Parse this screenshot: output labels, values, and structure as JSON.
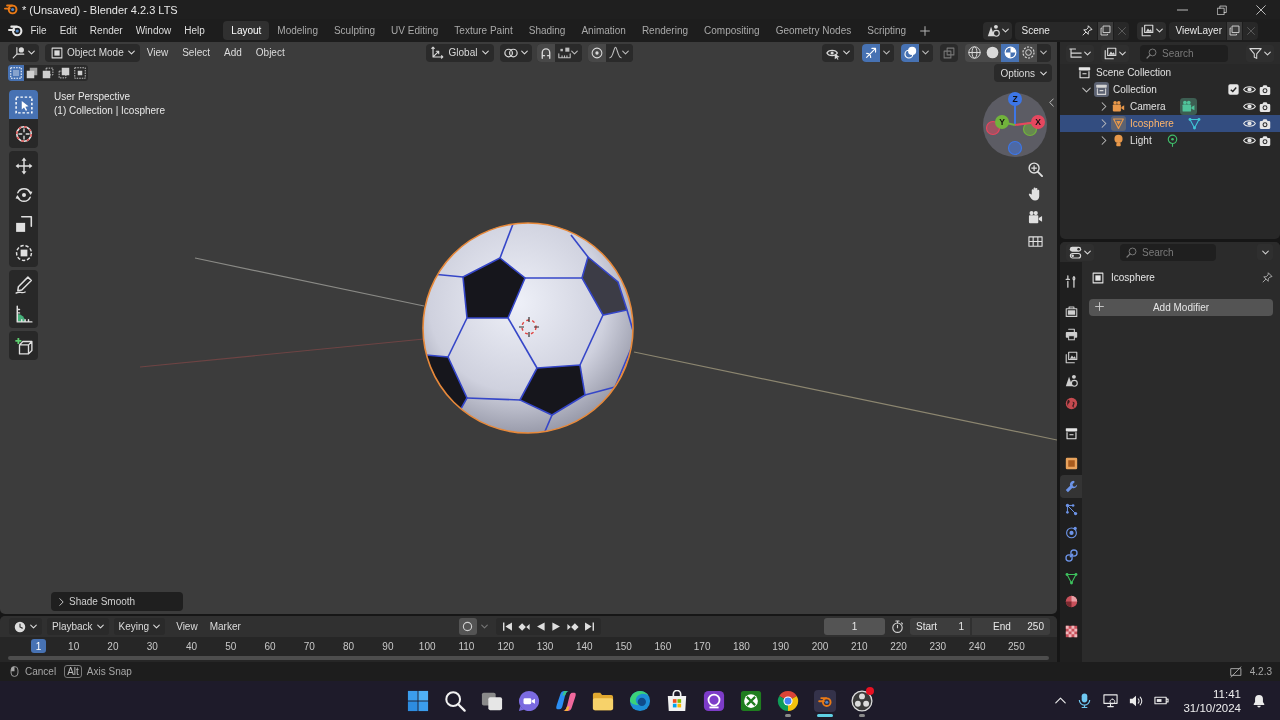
{
  "window": {
    "title": "* (Unsaved) - Blender 4.2.3 LTS"
  },
  "menus": [
    "File",
    "Edit",
    "Render",
    "Window",
    "Help"
  ],
  "workspaces": [
    {
      "label": "Layout",
      "selected": true
    },
    {
      "label": "Modeling",
      "selected": false
    },
    {
      "label": "Sculpting",
      "selected": false
    },
    {
      "label": "UV Editing",
      "selected": false
    },
    {
      "label": "Texture Paint",
      "selected": false
    },
    {
      "label": "Shading",
      "selected": false
    },
    {
      "label": "Animation",
      "selected": false
    },
    {
      "label": "Rendering",
      "selected": false
    },
    {
      "label": "Compositing",
      "selected": false
    },
    {
      "label": "Geometry Nodes",
      "selected": false
    },
    {
      "label": "Scripting",
      "selected": false
    }
  ],
  "scene": {
    "name": "Scene"
  },
  "view_layer": {
    "name": "ViewLayer"
  },
  "viewport": {
    "mode": "Object Mode",
    "menus": [
      "View",
      "Select",
      "Add",
      "Object"
    ],
    "orientation": "Global",
    "gizmos": true,
    "overlays": true,
    "xray": false,
    "shading": [
      {
        "kind": "wireframe",
        "selected": false
      },
      {
        "kind": "solid",
        "selected": false
      },
      {
        "kind": "material",
        "selected": true
      },
      {
        "kind": "rendered",
        "selected": false
      }
    ],
    "select_modes": [
      {
        "kind": "set",
        "selected": true
      },
      {
        "kind": "extend",
        "selected": false
      },
      {
        "kind": "subtract",
        "selected": false
      },
      {
        "kind": "invert",
        "selected": false
      },
      {
        "kind": "intersect",
        "selected": false
      }
    ],
    "options": "Options",
    "info": [
      "User Perspective",
      "(1) Collection | Icosphere"
    ],
    "tool_groups": [
      [
        {
          "kind": "select_box",
          "selected": true
        },
        {
          "kind": "cursor",
          "selected": false
        }
      ],
      [
        {
          "kind": "move",
          "selected": false
        },
        {
          "kind": "rotate",
          "selected": false
        },
        {
          "kind": "scale",
          "selected": false
        },
        {
          "kind": "transform",
          "selected": false
        }
      ],
      [
        {
          "kind": "annotate",
          "selected": false
        },
        {
          "kind": "measure",
          "selected": false
        }
      ],
      [
        {
          "kind": "add_cube",
          "selected": false
        }
      ]
    ],
    "gizmo_axes": [
      {
        "label": "Z",
        "color": "#3d76e6"
      },
      {
        "label": "X",
        "color": "#e6475f"
      },
      {
        "label": "Y",
        "color": "#71b33c"
      }
    ],
    "last_operator": "Shade Smooth"
  },
  "outliner": {
    "search": {
      "placeholder": "Search"
    },
    "tree": [
      {
        "label": "Scene Collection",
        "kind": "scene_collection",
        "selected": false,
        "active": false,
        "children": [
          {
            "label": "Collection",
            "kind": "collection",
            "selected": false,
            "active": true,
            "expanded": true,
            "checked": true,
            "visible": true,
            "renderable": true,
            "children": [
              {
                "label": "Camera",
                "kind": "camera",
                "selected": false,
                "active": false,
                "data_active": true,
                "expanded": false,
                "visible": true,
                "renderable": true
              },
              {
                "label": "Icosphere",
                "kind": "mesh",
                "selected": true,
                "active": true,
                "data_active": false,
                "expanded": false,
                "visible": true,
                "renderable": true
              },
              {
                "label": "Light",
                "kind": "light",
                "selected": false,
                "active": false,
                "data_active": false,
                "expanded": false,
                "visible": true,
                "renderable": true
              }
            ]
          }
        ]
      }
    ]
  },
  "properties": {
    "search": {
      "placeholder": "Search"
    },
    "tab_groups": [
      [
        {
          "kind": "tool",
          "selected": false
        }
      ],
      [
        {
          "kind": "render",
          "selected": false
        },
        {
          "kind": "output",
          "selected": false
        },
        {
          "kind": "view_layer",
          "selected": false
        },
        {
          "kind": "scene",
          "selected": false
        },
        {
          "kind": "world",
          "selected": false
        }
      ],
      [
        {
          "kind": "collection",
          "selected": false
        }
      ],
      [
        {
          "kind": "object",
          "selected": false
        },
        {
          "kind": "modifiers",
          "selected": true
        },
        {
          "kind": "particles",
          "selected": false
        },
        {
          "kind": "physics",
          "selected": false
        },
        {
          "kind": "constraints",
          "selected": false
        },
        {
          "kind": "data",
          "selected": false
        },
        {
          "kind": "material",
          "selected": false
        }
      ],
      [
        {
          "kind": "texture",
          "selected": false
        }
      ]
    ],
    "object": "Icosphere",
    "add_button": "Add Modifier"
  },
  "timeline": {
    "menus": [
      {
        "label": "Playback",
        "kind": "dropdown"
      },
      {
        "label": "Keying",
        "kind": "dropdown"
      },
      {
        "label": "View",
        "kind": "menu"
      },
      {
        "label": "Marker",
        "kind": "menu"
      }
    ],
    "auto_keying": false,
    "current_frame": "1",
    "start_label": "Start",
    "start": "1",
    "end_label": "End",
    "end": "250",
    "playhead": "1",
    "ticks": [
      "10",
      "20",
      "30",
      "40",
      "50",
      "60",
      "70",
      "80",
      "90",
      "100",
      "110",
      "120",
      "130",
      "140",
      "150",
      "160",
      "170",
      "180",
      "190",
      "200",
      "210",
      "220",
      "230",
      "240",
      "250"
    ]
  },
  "status_bar": {
    "hints": [
      {
        "kind": "mouse",
        "label": "Cancel"
      },
      {
        "kind": "key",
        "key": "Alt",
        "label": "Axis Snap"
      }
    ],
    "version": "4.2.3"
  },
  "taskbar": {
    "apps": [
      {
        "kind": "start",
        "running": false,
        "selected": false,
        "notification": false
      },
      {
        "kind": "search",
        "running": false,
        "selected": false,
        "notification": false
      },
      {
        "kind": "task_view",
        "running": false,
        "selected": false,
        "notification": false
      },
      {
        "kind": "video_call",
        "running": false,
        "selected": false,
        "notification": false
      },
      {
        "kind": "copilot",
        "running": false,
        "selected": false,
        "notification": false
      },
      {
        "kind": "files",
        "running": false,
        "selected": false,
        "notification": false
      },
      {
        "kind": "edge",
        "running": false,
        "selected": false,
        "notification": false
      },
      {
        "kind": "store",
        "running": false,
        "selected": false,
        "notification": false
      },
      {
        "kind": "ring_app",
        "running": false,
        "selected": false,
        "notification": false
      },
      {
        "kind": "xbox",
        "running": false,
        "selected": false,
        "notification": false
      },
      {
        "kind": "chrome",
        "running": true,
        "selected": false,
        "notification": false
      },
      {
        "kind": "blender",
        "running": true,
        "selected": true,
        "notification": false
      },
      {
        "kind": "obs",
        "running": true,
        "selected": false,
        "notification": true
      }
    ],
    "time": "11:41",
    "date": "31/10/2024"
  }
}
